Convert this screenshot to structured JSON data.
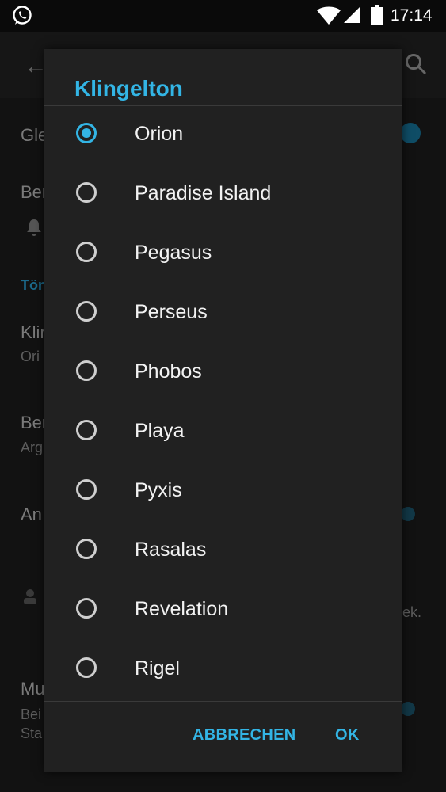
{
  "status_bar": {
    "time": "17:14",
    "icons": [
      "whatsapp-icon",
      "wifi-icon",
      "cell-signal-icon",
      "battery-icon"
    ]
  },
  "background": {
    "back_icon": "arrow-left-icon",
    "search_icon": "search-icon",
    "rows": [
      {
        "text": "Gle"
      },
      {
        "text": "Ber"
      },
      {
        "text": "Tön"
      },
      {
        "text": "Klin",
        "sub": "Ori"
      },
      {
        "text": "Ber",
        "sub": "Arg"
      },
      {
        "text": "An"
      },
      {
        "text": "ek."
      },
      {
        "text": "Mu",
        "sub": "Bei",
        "sub2": "Sta"
      }
    ]
  },
  "dialog": {
    "title": "Klingelton",
    "selected": "Orion",
    "options": [
      {
        "label": "Orion",
        "checked": true
      },
      {
        "label": "Paradise Island",
        "checked": false
      },
      {
        "label": "Pegasus",
        "checked": false
      },
      {
        "label": "Perseus",
        "checked": false
      },
      {
        "label": "Phobos",
        "checked": false
      },
      {
        "label": "Playa",
        "checked": false
      },
      {
        "label": "Pyxis",
        "checked": false
      },
      {
        "label": "Rasalas",
        "checked": false
      },
      {
        "label": "Revelation",
        "checked": false
      },
      {
        "label": "Rigel",
        "checked": false
      }
    ],
    "cancel_label": "ABBRECHEN",
    "ok_label": "OK"
  },
  "colors": {
    "accent": "#33b5e5",
    "dialog_bg": "#212121"
  }
}
